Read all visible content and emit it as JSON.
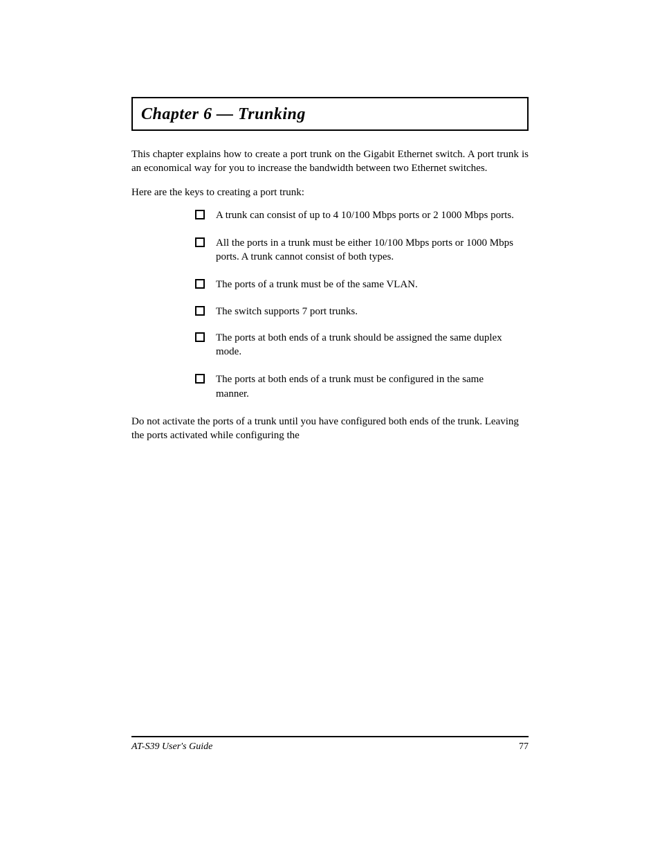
{
  "chapter": {
    "title": "Chapter 6 — Trunking"
  },
  "intro": "This chapter explains how to create a port trunk on the Gigabit Ethernet switch. A port trunk is an economical way for you to increase the bandwidth between two Ethernet switches.",
  "keys_intro": "Here are the keys to creating a port trunk:",
  "bullets": [
    "A trunk can consist of up to 4 10/100 Mbps ports or 2 1000 Mbps ports.",
    "All the ports in a trunk must be either 10/100 Mbps ports or 1000 Mbps ports. A trunk cannot consist of both types.",
    "The ports of a trunk must be of the same VLAN.",
    "The switch supports 7 port trunks.",
    "The ports at both ends of a trunk should be assigned the same duplex mode.",
    "The ports at both ends of a trunk must be configured in the same manner."
  ],
  "lead_in": "Do not activate the ports of a trunk until you have configured both ends of the trunk. Leaving the ports activated while configuring the",
  "footer": {
    "left": "AT-S39 User's Guide",
    "right": "77"
  }
}
